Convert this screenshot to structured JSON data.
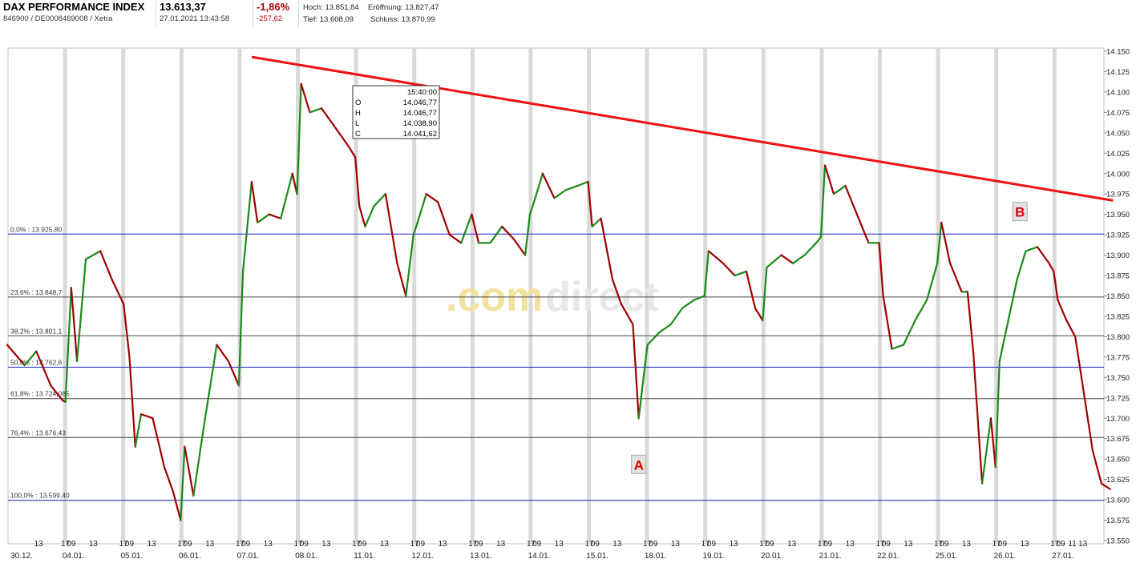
{
  "header": {
    "name": "DAX PERFORMANCE INDEX",
    "ids": "846900 / DE0008469008 / Xetra",
    "last": "13.613,37",
    "timestamp": "27.01.2021 13:43:58",
    "change_pct": "-1,86%",
    "change_abs": "-257,62",
    "high": "Hoch: 13.851,84",
    "open": "Eröffnung: 13.827,47",
    "low": "Tief: 13.608,09",
    "close": "Schluss: 13.870,99"
  },
  "colors": {
    "up": "#1a8a1a",
    "down": "#a00000",
    "trendline": "#ee1111",
    "fib_blue": "#1a1acc",
    "fib_dark": "#444444",
    "grid_band": "#dadada",
    "watermark": "#f1e2a0"
  },
  "watermark": {
    "prefix": ".com",
    "suffix": "direct"
  },
  "tooltip": {
    "time": "15:40:00",
    "O": "14.046,77",
    "H": "14.046,77",
    "L": "14.038,90",
    "C": "14.041,62"
  },
  "chart_data": {
    "type": "line",
    "ylim": [
      13550,
      14150
    ],
    "y_ticks": [
      "14.150",
      "14.125",
      "14.100",
      "14.075",
      "14.050",
      "14.025",
      "14.000",
      "13.975",
      "13.950",
      "13.925",
      "13.900",
      "13.875",
      "13.850",
      "13.825",
      "13.800",
      "13.775",
      "13.750",
      "13.725",
      "13.700",
      "13.675",
      "13.650",
      "13.625",
      "13.600",
      "13.575",
      "13.550"
    ],
    "days": [
      {
        "label": "30.12.",
        "ticks": [
          "13"
        ]
      },
      {
        "label": "04.01.",
        "ticks": [
          "17",
          "09",
          "13"
        ]
      },
      {
        "label": "05.01.",
        "ticks": [
          "17",
          "09",
          "13"
        ]
      },
      {
        "label": "06.01.",
        "ticks": [
          "17",
          "09",
          "13"
        ]
      },
      {
        "label": "07.01.",
        "ticks": [
          "17",
          "09",
          "13"
        ]
      },
      {
        "label": "08.01.",
        "ticks": [
          "17",
          "09",
          "13"
        ]
      },
      {
        "label": "11.01.",
        "ticks": [
          "17",
          "09",
          "13"
        ]
      },
      {
        "label": "12.01.",
        "ticks": [
          "17",
          "09",
          "13"
        ]
      },
      {
        "label": "13.01.",
        "ticks": [
          "17",
          "09",
          "13"
        ]
      },
      {
        "label": "14.01.",
        "ticks": [
          "17",
          "09",
          "13"
        ]
      },
      {
        "label": "15.01.",
        "ticks": [
          "17",
          "09",
          "13"
        ]
      },
      {
        "label": "18.01.",
        "ticks": [
          "17",
          "09",
          "13"
        ]
      },
      {
        "label": "19.01.",
        "ticks": [
          "17",
          "09",
          "13"
        ]
      },
      {
        "label": "20.01.",
        "ticks": [
          "17",
          "09",
          "13"
        ]
      },
      {
        "label": "21.01.",
        "ticks": [
          "17",
          "09",
          "13"
        ]
      },
      {
        "label": "22.01.",
        "ticks": [
          "17",
          "09",
          "13"
        ]
      },
      {
        "label": "25.01.",
        "ticks": [
          "17",
          "09",
          "13"
        ]
      },
      {
        "label": "26.01.",
        "ticks": [
          "17",
          "09",
          "13"
        ]
      },
      {
        "label": "27.01.",
        "ticks": [
          "17",
          "09",
          "11",
          "13"
        ]
      }
    ],
    "fibonacci": [
      {
        "label": "0,0% : 13.925,80",
        "value": 13925.8,
        "style": "blue"
      },
      {
        "label": "23,6% : 13.848,7",
        "value": 13848.7,
        "style": "dark"
      },
      {
        "label": "38,2% : 13.801,1",
        "value": 13801.1,
        "style": "dark"
      },
      {
        "label": "50,0% : 13.762,6",
        "value": 13762.6,
        "style": "blue"
      },
      {
        "label": "61,8% : 13.724,085",
        "value": 13724.1,
        "style": "dark"
      },
      {
        "label": "76,4% : 13.676,43",
        "value": 13676.4,
        "style": "dark"
      },
      {
        "label": "100,0% : 13.599,40",
        "value": 13599.4,
        "style": "blue"
      }
    ],
    "trendline": {
      "start": {
        "day": 4.2,
        "value": 14143
      },
      "end": {
        "day": 19.0,
        "value": 13967
      }
    },
    "markers": [
      {
        "label": "A",
        "day": 10.85,
        "value": 13643
      },
      {
        "label": "B",
        "day": 17.4,
        "value": 13953
      }
    ],
    "series": [
      {
        "points": [
          [
            0.0,
            13790
          ],
          [
            0.3,
            13765
          ],
          [
            0.5,
            13782
          ],
          [
            0.75,
            13740
          ],
          [
            0.95,
            13722
          ],
          [
            1.0,
            13720
          ],
          [
            1.1,
            13860
          ],
          [
            1.2,
            13770
          ],
          [
            1.35,
            13895
          ],
          [
            1.6,
            13905
          ],
          [
            1.8,
            13870
          ],
          [
            2.0,
            13840
          ],
          [
            2.1,
            13775
          ],
          [
            2.2,
            13665
          ],
          [
            2.3,
            13705
          ],
          [
            2.5,
            13700
          ],
          [
            2.7,
            13640
          ],
          [
            2.85,
            13610
          ],
          [
            2.98,
            13575
          ],
          [
            3.05,
            13665
          ],
          [
            3.2,
            13605
          ],
          [
            3.4,
            13700
          ],
          [
            3.6,
            13790
          ],
          [
            3.8,
            13770
          ],
          [
            3.98,
            13740
          ],
          [
            4.05,
            13880
          ],
          [
            4.2,
            13990
          ],
          [
            4.3,
            13940
          ],
          [
            4.5,
            13950
          ],
          [
            4.7,
            13945
          ],
          [
            4.9,
            14000
          ],
          [
            4.98,
            13975
          ],
          [
            5.05,
            14110
          ],
          [
            5.2,
            14075
          ],
          [
            5.4,
            14080
          ],
          [
            5.6,
            14060
          ],
          [
            5.85,
            14035
          ],
          [
            5.98,
            14020
          ],
          [
            6.05,
            13960
          ],
          [
            6.15,
            13935
          ],
          [
            6.3,
            13960
          ],
          [
            6.5,
            13975
          ],
          [
            6.7,
            13890
          ],
          [
            6.85,
            13850
          ],
          [
            6.98,
            13925
          ],
          [
            7.05,
            13940
          ],
          [
            7.2,
            13975
          ],
          [
            7.4,
            13965
          ],
          [
            7.6,
            13925
          ],
          [
            7.8,
            13915
          ],
          [
            7.98,
            13950
          ],
          [
            8.1,
            13915
          ],
          [
            8.3,
            13915
          ],
          [
            8.5,
            13935
          ],
          [
            8.7,
            13920
          ],
          [
            8.9,
            13900
          ],
          [
            8.98,
            13950
          ],
          [
            9.05,
            13965
          ],
          [
            9.2,
            14000
          ],
          [
            9.4,
            13970
          ],
          [
            9.6,
            13980
          ],
          [
            9.8,
            13985
          ],
          [
            9.98,
            13990
          ],
          [
            10.05,
            13935
          ],
          [
            10.2,
            13945
          ],
          [
            10.4,
            13870
          ],
          [
            10.55,
            13840
          ],
          [
            10.75,
            13815
          ],
          [
            10.85,
            13700
          ],
          [
            11.0,
            13790
          ],
          [
            11.2,
            13805
          ],
          [
            11.4,
            13815
          ],
          [
            11.6,
            13835
          ],
          [
            11.8,
            13845
          ],
          [
            11.98,
            13850
          ],
          [
            12.05,
            13905
          ],
          [
            12.3,
            13890
          ],
          [
            12.5,
            13875
          ],
          [
            12.7,
            13880
          ],
          [
            12.85,
            13835
          ],
          [
            12.98,
            13820
          ],
          [
            13.05,
            13885
          ],
          [
            13.3,
            13900
          ],
          [
            13.5,
            13890
          ],
          [
            13.7,
            13900
          ],
          [
            13.9,
            13915
          ],
          [
            13.98,
            13922
          ],
          [
            14.05,
            14010
          ],
          [
            14.2,
            13975
          ],
          [
            14.4,
            13985
          ],
          [
            14.6,
            13950
          ],
          [
            14.8,
            13915
          ],
          [
            14.98,
            13915
          ],
          [
            15.05,
            13850
          ],
          [
            15.2,
            13785
          ],
          [
            15.4,
            13790
          ],
          [
            15.6,
            13820
          ],
          [
            15.8,
            13845
          ],
          [
            15.98,
            13890
          ],
          [
            16.05,
            13940
          ],
          [
            16.2,
            13890
          ],
          [
            16.4,
            13855
          ],
          [
            16.5,
            13855
          ],
          [
            16.6,
            13780
          ],
          [
            16.75,
            13620
          ],
          [
            16.9,
            13700
          ],
          [
            16.98,
            13640
          ],
          [
            17.05,
            13770
          ],
          [
            17.2,
            13820
          ],
          [
            17.35,
            13870
          ],
          [
            17.5,
            13905
          ],
          [
            17.7,
            13910
          ],
          [
            17.9,
            13890
          ],
          [
            17.98,
            13880
          ],
          [
            18.05,
            13845
          ],
          [
            18.2,
            13820
          ],
          [
            18.35,
            13800
          ],
          [
            18.5,
            13730
          ],
          [
            18.65,
            13660
          ],
          [
            18.8,
            13620
          ],
          [
            18.95,
            13613
          ]
        ]
      }
    ]
  }
}
